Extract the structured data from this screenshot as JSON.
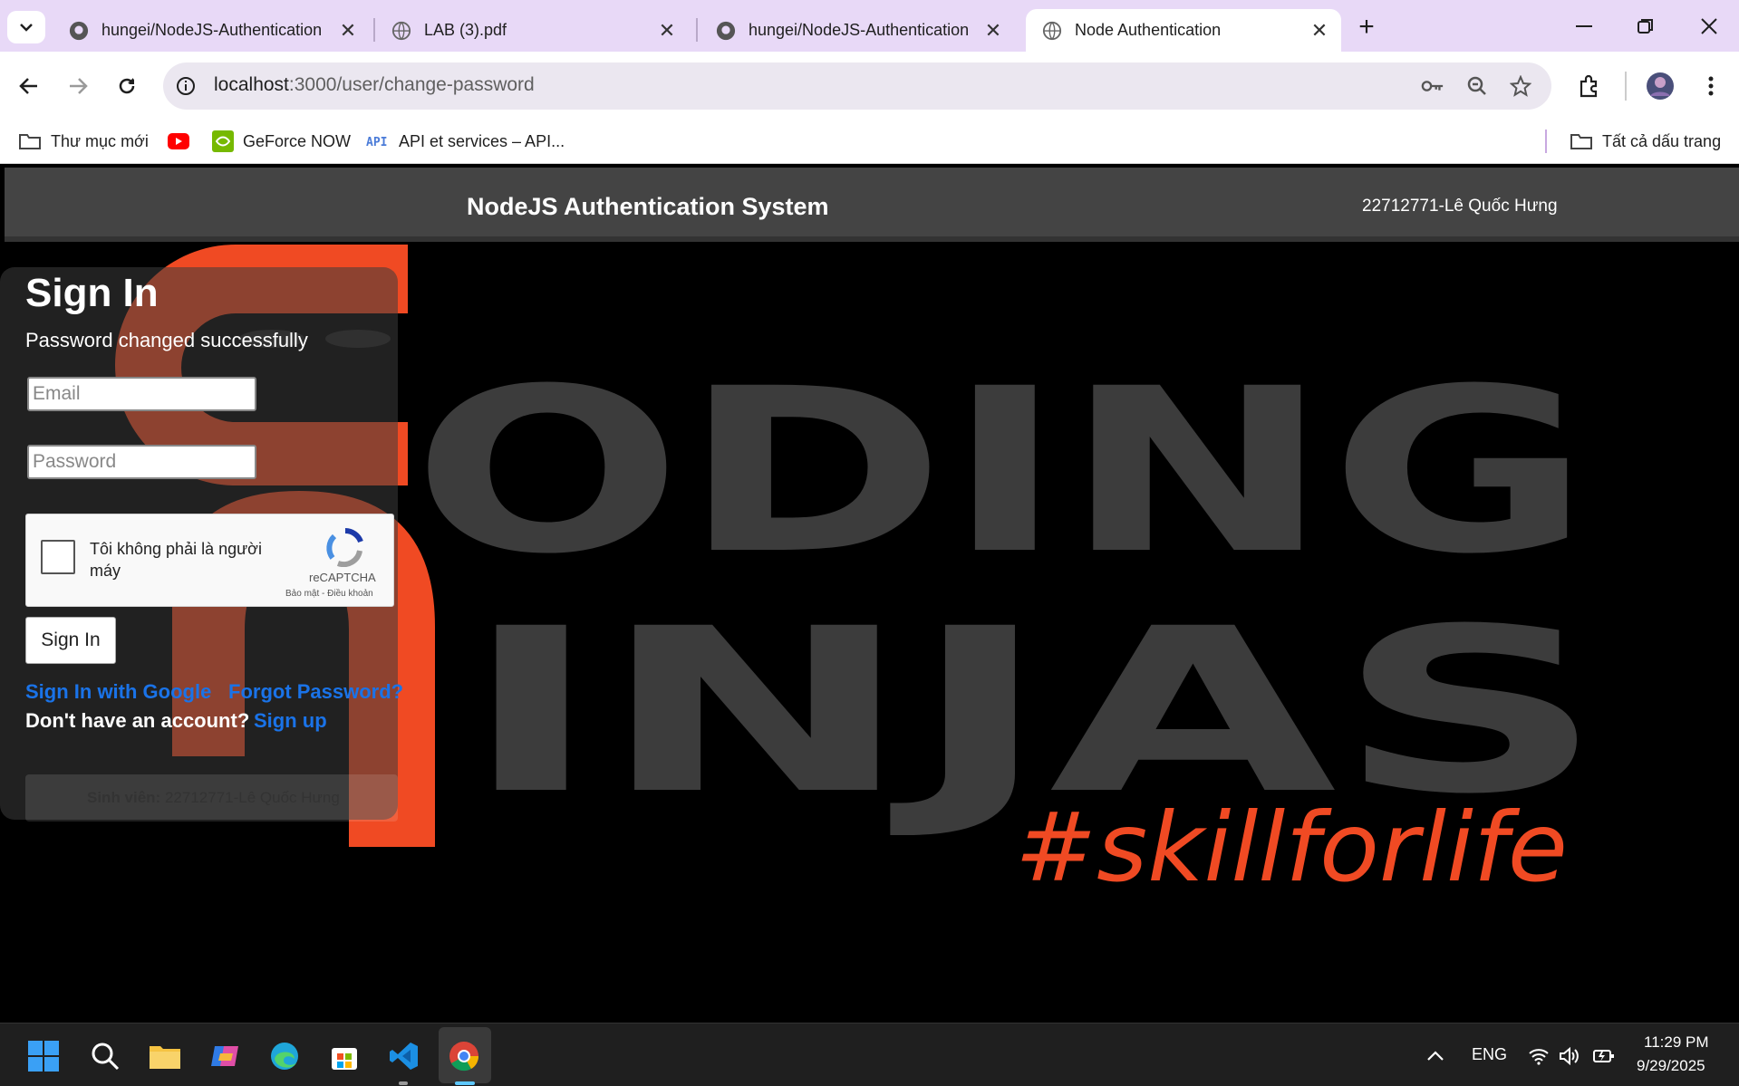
{
  "browser": {
    "tabs": [
      {
        "label": "hungei/NodeJS-Authentication",
        "icon": "github-icon",
        "active": false
      },
      {
        "label": "LAB (3).pdf",
        "icon": "globe-icon",
        "active": false
      },
      {
        "label": "hungei/NodeJS-Authentication",
        "icon": "github-icon",
        "active": false
      },
      {
        "label": "Node Authentication",
        "icon": "globe-icon",
        "active": true
      }
    ],
    "url_host": "localhost",
    "url_path": ":3000/user/change-password",
    "bookmarks": [
      {
        "label": "Thư mục mới",
        "icon": "folder-icon"
      },
      {
        "label": "",
        "icon": "youtube-icon"
      },
      {
        "label": "GeForce NOW",
        "icon": "nvidia-icon"
      },
      {
        "label": "API et services – API...",
        "icon": "api-icon"
      }
    ],
    "all_bookmarks": "Tất cả dấu trang"
  },
  "site": {
    "title": "NodeJS Authentication System",
    "user": "22712771-Lê Quốc Hưng"
  },
  "background": {
    "line1": "ODING",
    "line2": "INJAS",
    "tagline": "#skillforlife",
    "accent": "#f04a23",
    "letter_color": "#3c3c3c"
  },
  "signin": {
    "title": "Sign In",
    "flash": "Password changed successfully",
    "email_placeholder": "Email",
    "password_placeholder": "Password",
    "captcha_label": "Tôi không phải là người máy",
    "captcha_brand": "reCAPTCHA",
    "captcha_terms": "Bảo mật - Điều khoản",
    "button": "Sign In",
    "google_link": "Sign In with Google",
    "forgot_link": "Forgot Password?",
    "no_account": "Don't have an account?",
    "signup_link": "Sign up",
    "footer_label": "Sinh viên:",
    "footer_value": "22712771-Lê Quốc Hưng"
  },
  "taskbar": {
    "lang": "ENG",
    "time": "11:29 PM",
    "date": "9/29/2025"
  }
}
